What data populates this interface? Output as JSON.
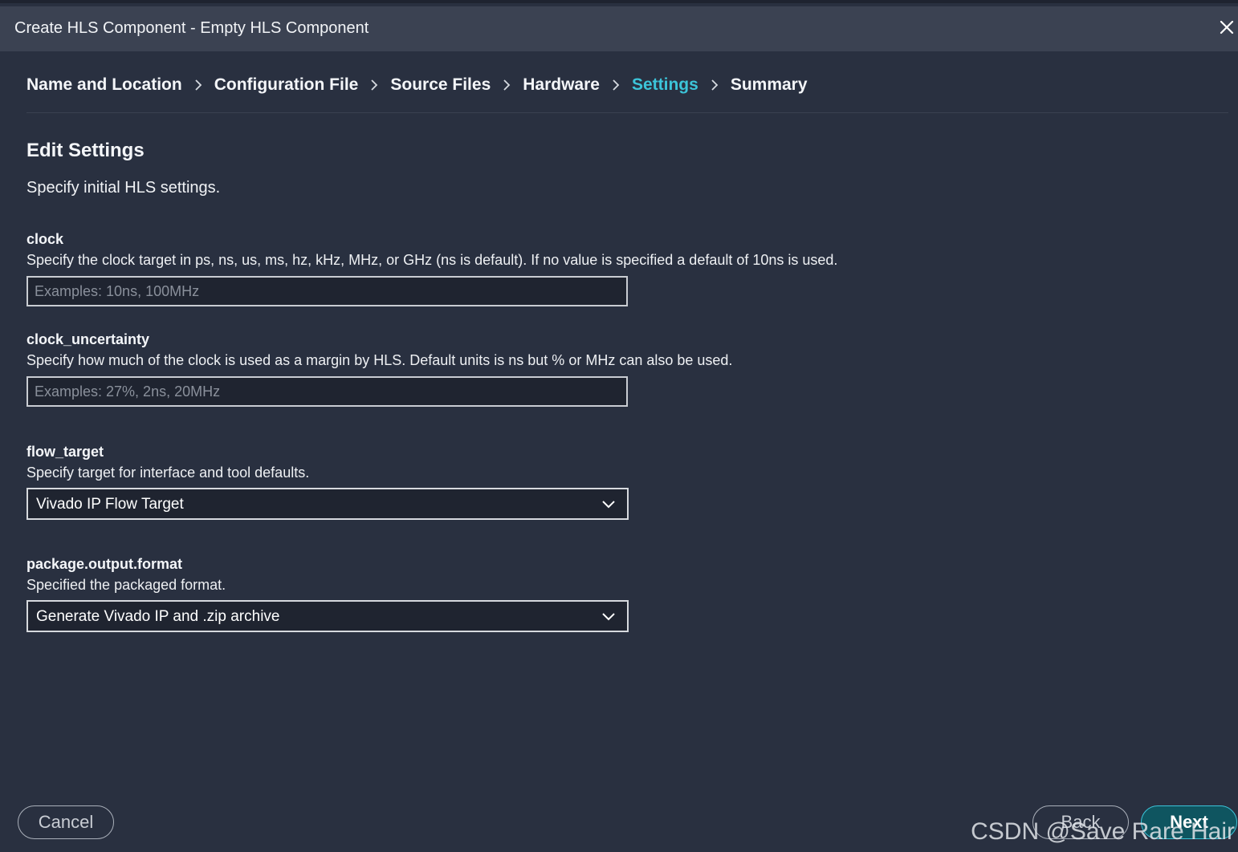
{
  "window": {
    "title": "Create HLS Component - Empty HLS Component",
    "close_icon": "close-icon"
  },
  "breadcrumb": {
    "steps": [
      {
        "label": "Name and Location",
        "active": false
      },
      {
        "label": "Configuration File",
        "active": false
      },
      {
        "label": "Source Files",
        "active": false
      },
      {
        "label": "Hardware",
        "active": false
      },
      {
        "label": "Settings",
        "active": true
      },
      {
        "label": "Summary",
        "active": false
      }
    ],
    "separator_icon": "chevron-right-icon",
    "active_color": "#3cc4d9"
  },
  "page": {
    "heading": "Edit Settings",
    "subheading": "Specify initial HLS settings."
  },
  "fields": {
    "clock": {
      "label": "clock",
      "description": "Specify the clock target in ps, ns, us, ms, hz, kHz, MHz, or GHz (ns is default). If no value is specified a default of 10ns is used.",
      "value": "",
      "placeholder": "Examples: 10ns, 100MHz"
    },
    "clock_uncertainty": {
      "label": "clock_uncertainty",
      "description": "Specify how much of the clock is used as a margin by HLS. Default units is ns but % or MHz can also be used.",
      "value": "",
      "placeholder": "Examples: 27%, 2ns, 20MHz"
    },
    "flow_target": {
      "label": "flow_target",
      "description": "Specify target for interface and tool defaults.",
      "selected": "Vivado IP Flow Target"
    },
    "package_output_format": {
      "label": "package.output.format",
      "description": "Specified the packaged format.",
      "selected": "Generate Vivado IP and .zip archive"
    }
  },
  "footer": {
    "cancel_label": "Cancel",
    "back_label": "Back",
    "next_label": "Next"
  },
  "watermark": "CSDN @Save Rare Hair"
}
